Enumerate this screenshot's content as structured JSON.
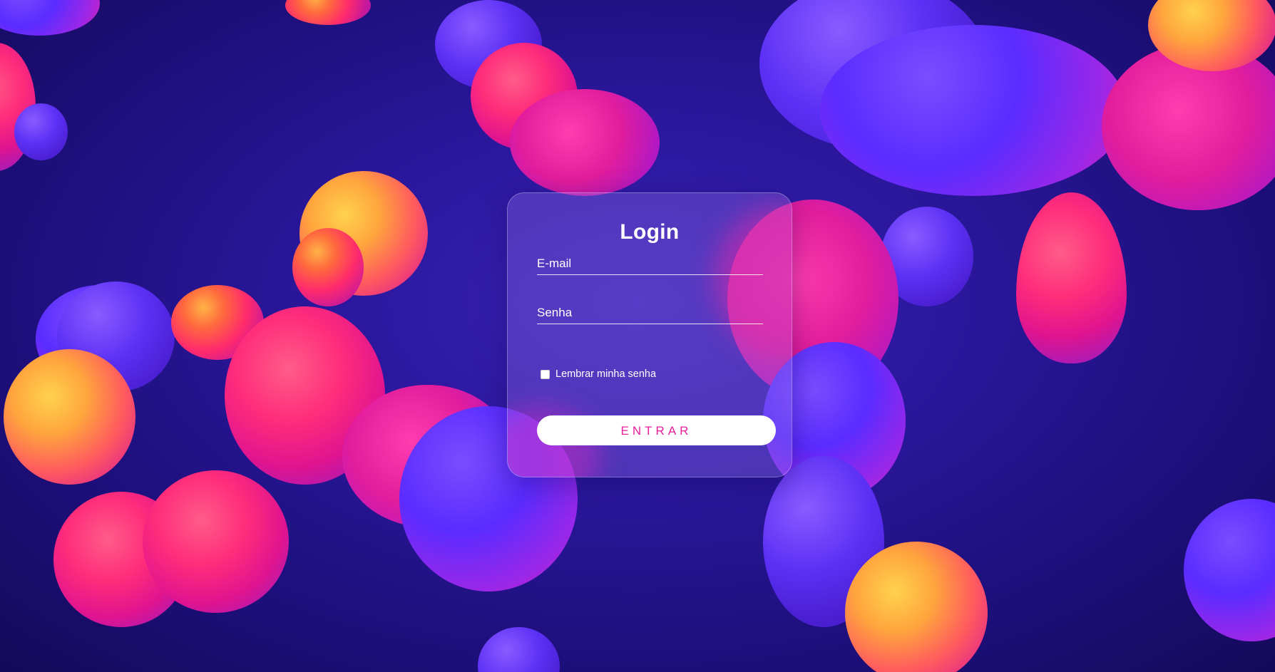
{
  "login": {
    "title": "Login",
    "email_placeholder": "E-mail",
    "password_placeholder": "Senha",
    "remember_label": "Lembrar minha senha",
    "remember_checked": false,
    "submit_label": "ENTRAR"
  },
  "colors": {
    "background": "#2a179c",
    "button_text": "#e61e9a",
    "button_background": "#ffffff",
    "text": "#ffffff"
  }
}
